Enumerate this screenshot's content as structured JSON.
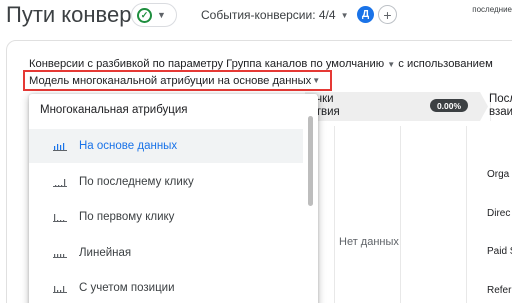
{
  "header": {
    "title": "Пути конверсии",
    "events_label": "События-конверсии: 4/4",
    "avatar_letter": "Д",
    "add_symbol": "+",
    "last_updated": "последние"
  },
  "settings": {
    "line": "Конверсии с разбивкой по параметру Группа каналов по умолчанию",
    "line_suffix": "с использованием",
    "model_label": "Модель многоканальной атрибуции на основе данных"
  },
  "report": {
    "column1_line1": "очки",
    "column1_line2": "ствия",
    "badge": "0.00%",
    "column2_line1": "Посл",
    "column2_line2": "взаи",
    "no_data": "Нет данных",
    "channels": [
      "Orga",
      "Direc",
      "Paid S",
      "Refer"
    ]
  },
  "menu": {
    "heading": "Многоканальная атрибуция",
    "items": [
      {
        "label": "На основе данных",
        "icon": "data-driven-icon",
        "selected": true
      },
      {
        "label": "По последнему клику",
        "icon": "last-click-icon",
        "selected": false
      },
      {
        "label": "По первому клику",
        "icon": "first-click-icon",
        "selected": false
      },
      {
        "label": "Линейная",
        "icon": "linear-icon",
        "selected": false
      },
      {
        "label": "С учетом позиции",
        "icon": "position-based-icon",
        "selected": false
      }
    ]
  },
  "colors": {
    "accent": "#1a73e8",
    "highlight_border": "#e53935",
    "success": "#1e8e3e",
    "badge_bg": "#3c4043"
  }
}
